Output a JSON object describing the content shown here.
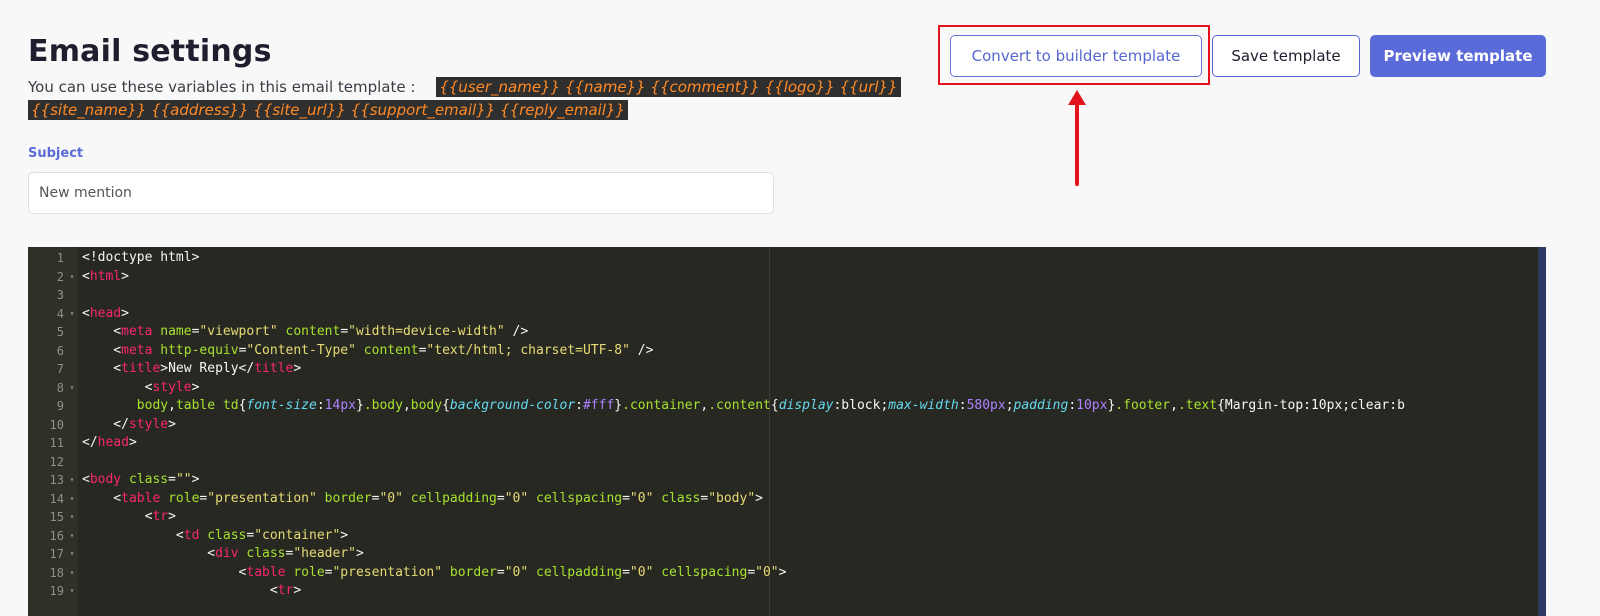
{
  "header": {
    "title": "Email settings",
    "variables_intro": "You can use these variables in this email template :",
    "variables_line1": "{{user_name}} {{name}} {{comment}} {{logo}} {{url}}",
    "variables_line2": "{{site_name}} {{address}} {{site_url}} {{support_email}} {{reply_email}}"
  },
  "actions": {
    "convert_label": "Convert to builder template",
    "save_label": "Save template",
    "preview_label": "Preview template"
  },
  "subject": {
    "label": "Subject",
    "value": "New mention"
  },
  "annotation": {
    "box_color": "#e3131b",
    "arrow_color": "#e3131b"
  },
  "editor": {
    "theme": "monokai",
    "lines": [
      {
        "n": "1",
        "fold": false,
        "text": "<!doctype html>"
      },
      {
        "n": "2",
        "fold": true,
        "text": "<html>"
      },
      {
        "n": "3",
        "fold": false,
        "text": ""
      },
      {
        "n": "4",
        "fold": true,
        "text": "<head>"
      },
      {
        "n": "5",
        "fold": false,
        "text": "    <meta name=\"viewport\" content=\"width=device-width\" />"
      },
      {
        "n": "6",
        "fold": false,
        "text": "    <meta http-equiv=\"Content-Type\" content=\"text/html; charset=UTF-8\" />"
      },
      {
        "n": "7",
        "fold": false,
        "text": "    <title>New Reply</title>"
      },
      {
        "n": "8",
        "fold": true,
        "text": "        <style>"
      },
      {
        "n": "9",
        "fold": false,
        "text": "       body,table td{font-size:14px}.body,body{background-color:#fff}.container,.content{display:block;max-width:580px;padding:10px}.footer,.text{Margin-top:10px;clear:b"
      },
      {
        "n": "10",
        "fold": false,
        "text": "    </style>"
      },
      {
        "n": "11",
        "fold": false,
        "text": "</head>"
      },
      {
        "n": "12",
        "fold": false,
        "text": ""
      },
      {
        "n": "13",
        "fold": true,
        "text": "<body class=\"\">"
      },
      {
        "n": "14",
        "fold": true,
        "text": "    <table role=\"presentation\" border=\"0\" cellpadding=\"0\" cellspacing=\"0\" class=\"body\">"
      },
      {
        "n": "15",
        "fold": true,
        "text": "        <tr>"
      },
      {
        "n": "16",
        "fold": true,
        "text": "            <td class=\"container\">"
      },
      {
        "n": "17",
        "fold": true,
        "text": "                <div class=\"header\">"
      },
      {
        "n": "18",
        "fold": true,
        "text": "                    <table role=\"presentation\" border=\"0\" cellpadding=\"0\" cellspacing=\"0\">"
      },
      {
        "n": "19",
        "fold": true,
        "text": "                        <tr>"
      }
    ]
  }
}
